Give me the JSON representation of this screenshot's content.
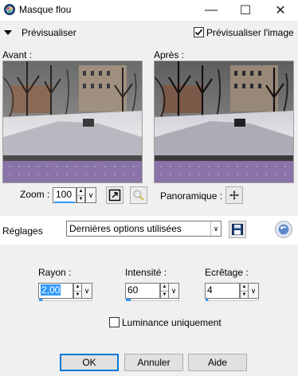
{
  "window": {
    "title": "Masque flou",
    "minimize_glyph": "—",
    "maximize_glyph": "☐",
    "close_glyph": "✕"
  },
  "preview_section": {
    "toggle_label": "Prévisualiser",
    "preview_image_label": "Prévisualiser l'image",
    "preview_image_checked": true
  },
  "panels": {
    "before_label": "Avant :",
    "after_label": "Après :"
  },
  "zoom": {
    "label": "Zoom :",
    "value": "100",
    "pan_label": "Panoramique :"
  },
  "settings": {
    "label": "Réglages",
    "preset": "Dernières options utilisées"
  },
  "params": {
    "rayon": {
      "label": "Rayon :",
      "value": "2,00"
    },
    "intensite": {
      "label": "Intensité :",
      "value": "60"
    },
    "ecretage": {
      "label": "Ecrêtage :",
      "value": "4"
    }
  },
  "luminance": {
    "label": "Luminance uniquement",
    "checked": false
  },
  "buttons": {
    "ok": "OK",
    "cancel": "Annuler",
    "help": "Aide"
  },
  "icons": {
    "app": "paintshop-icon",
    "collapse": "triangle-down-icon",
    "fit": "fit-window-icon",
    "zoom_tool": "zoom-tool-icon",
    "pan": "pan-move-icon",
    "save": "floppy-disk-icon",
    "reset": "reset-arrow-icon"
  },
  "colors": {
    "accent": "#3399ff",
    "preview_band": "#8a73a8"
  }
}
